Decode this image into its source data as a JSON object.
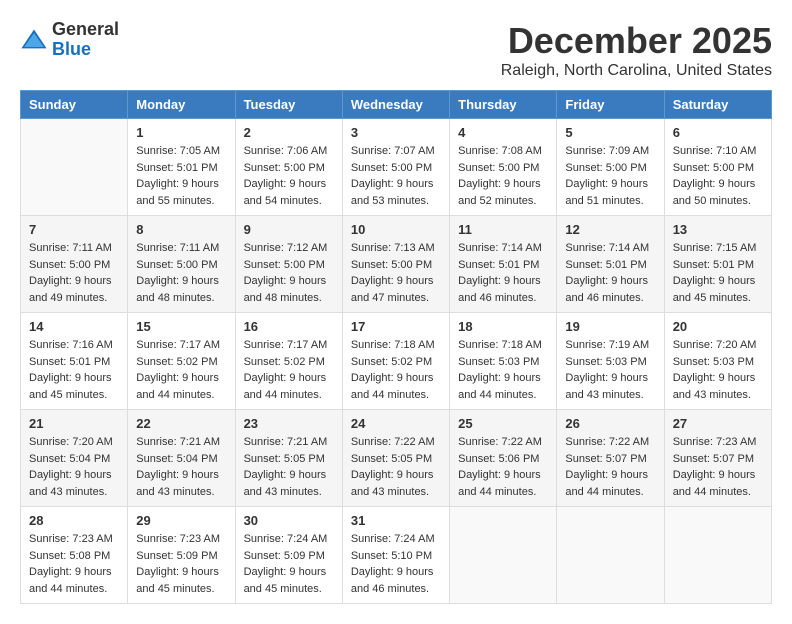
{
  "header": {
    "logo": {
      "general": "General",
      "blue": "Blue"
    },
    "title": "December 2025",
    "location": "Raleigh, North Carolina, United States"
  },
  "days_of_week": [
    "Sunday",
    "Monday",
    "Tuesday",
    "Wednesday",
    "Thursday",
    "Friday",
    "Saturday"
  ],
  "weeks": [
    [
      {
        "day": "",
        "info": ""
      },
      {
        "day": "1",
        "info": "Sunrise: 7:05 AM\nSunset: 5:01 PM\nDaylight: 9 hours\nand 55 minutes."
      },
      {
        "day": "2",
        "info": "Sunrise: 7:06 AM\nSunset: 5:00 PM\nDaylight: 9 hours\nand 54 minutes."
      },
      {
        "day": "3",
        "info": "Sunrise: 7:07 AM\nSunset: 5:00 PM\nDaylight: 9 hours\nand 53 minutes."
      },
      {
        "day": "4",
        "info": "Sunrise: 7:08 AM\nSunset: 5:00 PM\nDaylight: 9 hours\nand 52 minutes."
      },
      {
        "day": "5",
        "info": "Sunrise: 7:09 AM\nSunset: 5:00 PM\nDaylight: 9 hours\nand 51 minutes."
      },
      {
        "day": "6",
        "info": "Sunrise: 7:10 AM\nSunset: 5:00 PM\nDaylight: 9 hours\nand 50 minutes."
      }
    ],
    [
      {
        "day": "7",
        "info": "Sunrise: 7:11 AM\nSunset: 5:00 PM\nDaylight: 9 hours\nand 49 minutes."
      },
      {
        "day": "8",
        "info": "Sunrise: 7:11 AM\nSunset: 5:00 PM\nDaylight: 9 hours\nand 48 minutes."
      },
      {
        "day": "9",
        "info": "Sunrise: 7:12 AM\nSunset: 5:00 PM\nDaylight: 9 hours\nand 48 minutes."
      },
      {
        "day": "10",
        "info": "Sunrise: 7:13 AM\nSunset: 5:00 PM\nDaylight: 9 hours\nand 47 minutes."
      },
      {
        "day": "11",
        "info": "Sunrise: 7:14 AM\nSunset: 5:01 PM\nDaylight: 9 hours\nand 46 minutes."
      },
      {
        "day": "12",
        "info": "Sunrise: 7:14 AM\nSunset: 5:01 PM\nDaylight: 9 hours\nand 46 minutes."
      },
      {
        "day": "13",
        "info": "Sunrise: 7:15 AM\nSunset: 5:01 PM\nDaylight: 9 hours\nand 45 minutes."
      }
    ],
    [
      {
        "day": "14",
        "info": "Sunrise: 7:16 AM\nSunset: 5:01 PM\nDaylight: 9 hours\nand 45 minutes."
      },
      {
        "day": "15",
        "info": "Sunrise: 7:17 AM\nSunset: 5:02 PM\nDaylight: 9 hours\nand 44 minutes."
      },
      {
        "day": "16",
        "info": "Sunrise: 7:17 AM\nSunset: 5:02 PM\nDaylight: 9 hours\nand 44 minutes."
      },
      {
        "day": "17",
        "info": "Sunrise: 7:18 AM\nSunset: 5:02 PM\nDaylight: 9 hours\nand 44 minutes."
      },
      {
        "day": "18",
        "info": "Sunrise: 7:18 AM\nSunset: 5:03 PM\nDaylight: 9 hours\nand 44 minutes."
      },
      {
        "day": "19",
        "info": "Sunrise: 7:19 AM\nSunset: 5:03 PM\nDaylight: 9 hours\nand 43 minutes."
      },
      {
        "day": "20",
        "info": "Sunrise: 7:20 AM\nSunset: 5:03 PM\nDaylight: 9 hours\nand 43 minutes."
      }
    ],
    [
      {
        "day": "21",
        "info": "Sunrise: 7:20 AM\nSunset: 5:04 PM\nDaylight: 9 hours\nand 43 minutes."
      },
      {
        "day": "22",
        "info": "Sunrise: 7:21 AM\nSunset: 5:04 PM\nDaylight: 9 hours\nand 43 minutes."
      },
      {
        "day": "23",
        "info": "Sunrise: 7:21 AM\nSunset: 5:05 PM\nDaylight: 9 hours\nand 43 minutes."
      },
      {
        "day": "24",
        "info": "Sunrise: 7:22 AM\nSunset: 5:05 PM\nDaylight: 9 hours\nand 43 minutes."
      },
      {
        "day": "25",
        "info": "Sunrise: 7:22 AM\nSunset: 5:06 PM\nDaylight: 9 hours\nand 44 minutes."
      },
      {
        "day": "26",
        "info": "Sunrise: 7:22 AM\nSunset: 5:07 PM\nDaylight: 9 hours\nand 44 minutes."
      },
      {
        "day": "27",
        "info": "Sunrise: 7:23 AM\nSunset: 5:07 PM\nDaylight: 9 hours\nand 44 minutes."
      }
    ],
    [
      {
        "day": "28",
        "info": "Sunrise: 7:23 AM\nSunset: 5:08 PM\nDaylight: 9 hours\nand 44 minutes."
      },
      {
        "day": "29",
        "info": "Sunrise: 7:23 AM\nSunset: 5:09 PM\nDaylight: 9 hours\nand 45 minutes."
      },
      {
        "day": "30",
        "info": "Sunrise: 7:24 AM\nSunset: 5:09 PM\nDaylight: 9 hours\nand 45 minutes."
      },
      {
        "day": "31",
        "info": "Sunrise: 7:24 AM\nSunset: 5:10 PM\nDaylight: 9 hours\nand 46 minutes."
      },
      {
        "day": "",
        "info": ""
      },
      {
        "day": "",
        "info": ""
      },
      {
        "day": "",
        "info": ""
      }
    ]
  ]
}
